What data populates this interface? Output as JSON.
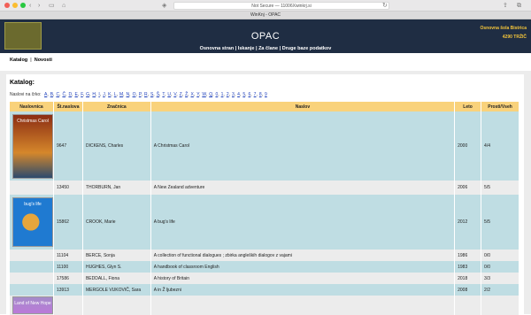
{
  "browser": {
    "back": "‹",
    "forward": "›",
    "address": "Not Secure — 11006Xwinkrj.si",
    "tab_title": "WinKnj - OPAC"
  },
  "header": {
    "title": "OPAC",
    "menu": [
      "Osnovna stran",
      "Iskanje",
      "Za člane",
      "Druge baze podatkov"
    ],
    "school_name": "Osnovna šola Bistrica",
    "school_place": "4290 TRŽIČ"
  },
  "subnav": [
    "Katalog",
    "Novosti"
  ],
  "catalog": {
    "heading": "Katalog:",
    "alpha_label": "Naslovi na črko:",
    "letters": [
      "A",
      "B",
      "C",
      "Č",
      "D",
      "E",
      "F",
      "G",
      "H",
      "I",
      "J",
      "K",
      "L",
      "M",
      "N",
      "O",
      "P",
      "R",
      "S",
      "Š",
      "T",
      "U",
      "V",
      "Z",
      "Ž",
      "X",
      "Y",
      "W",
      "Q",
      "0",
      "1",
      "2",
      "3",
      "4",
      "5",
      "6",
      "7",
      "8",
      "9"
    ],
    "columns": [
      "Naslovnica",
      "Št.naslova",
      "Značnica",
      "Naslov",
      "Leto",
      "Prosti/Vseh"
    ],
    "rows": [
      {
        "id": "9647",
        "author": "DICKENS, Charles",
        "title": "A Christmas Carol",
        "year": "2000",
        "avail": "4/4",
        "cover": "Christmas Carol"
      },
      {
        "id": "13450",
        "author": "THORBURN, Jan",
        "title": "A New Zealand adventure",
        "year": "2006",
        "avail": "5/5",
        "cover": ""
      },
      {
        "id": "15862",
        "author": "CROOK, Marie",
        "title": "A bug's life",
        "year": "2012",
        "avail": "5/5",
        "cover": "bug's life"
      },
      {
        "id": "11104",
        "author": "BERCE, Sonja",
        "title": "A collection of functional dialogues ; zbirka angleških dialogov z vajami",
        "year": "1986",
        "avail": "0/0",
        "cover": ""
      },
      {
        "id": "11100",
        "author": "HUGHES, Glyn S.",
        "title": "A handbook of classroom English",
        "year": "1983",
        "avail": "0/0",
        "cover": ""
      },
      {
        "id": "17586",
        "author": "BEDDALL, Fiona",
        "title": "A history of Britain",
        "year": "2018",
        "avail": "3/3",
        "cover": ""
      },
      {
        "id": "13913",
        "author": "MERGOLE VUKOVIČ, Sara",
        "title": "A in Ž ljubezni",
        "year": "2008",
        "avail": "2/2",
        "cover": ""
      },
      {
        "id": "",
        "author": "",
        "title": "",
        "year": "",
        "avail": "",
        "cover": "Land of New Hope"
      }
    ]
  }
}
